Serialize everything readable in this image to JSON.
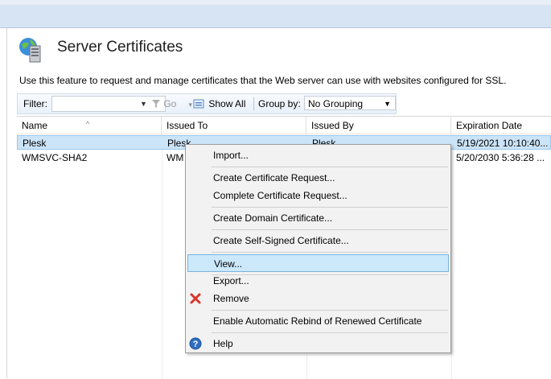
{
  "header": {
    "title": "Server Certificates",
    "description": "Use this feature to request and manage certificates that the Web server can use with websites configured for SSL."
  },
  "toolbar": {
    "filter_label": "Filter:",
    "filter_value": "",
    "go_label": "Go",
    "show_all_label": "Show All",
    "group_by_label": "Group by:",
    "group_by_value": "No Grouping"
  },
  "table": {
    "columns": [
      "Name",
      "Issued To",
      "Issued By",
      "Expiration Date"
    ],
    "rows": [
      {
        "name": "Plesk",
        "issued_to": "Plesk",
        "issued_by": "Plesk",
        "expiration": "5/19/2021 10:10:40..."
      },
      {
        "name": "WMSVC-SHA2",
        "issued_to": "WM",
        "issued_by": "",
        "expiration": "5/20/2030 5:36:28 ..."
      }
    ]
  },
  "context_menu": {
    "items": [
      "Import...",
      "Create Certificate Request...",
      "Complete Certificate Request...",
      "Create Domain Certificate...",
      "Create Self-Signed Certificate...",
      "View...",
      "Export...",
      "Remove",
      "Enable Automatic Rebind of Renewed Certificate",
      "Help"
    ],
    "highlighted": "View..."
  },
  "colors": {
    "selection": "#cce4f7",
    "menu_hover": "#cce8fb",
    "remove_icon": "#d9342b",
    "help_icon": "#2f6fc0"
  }
}
